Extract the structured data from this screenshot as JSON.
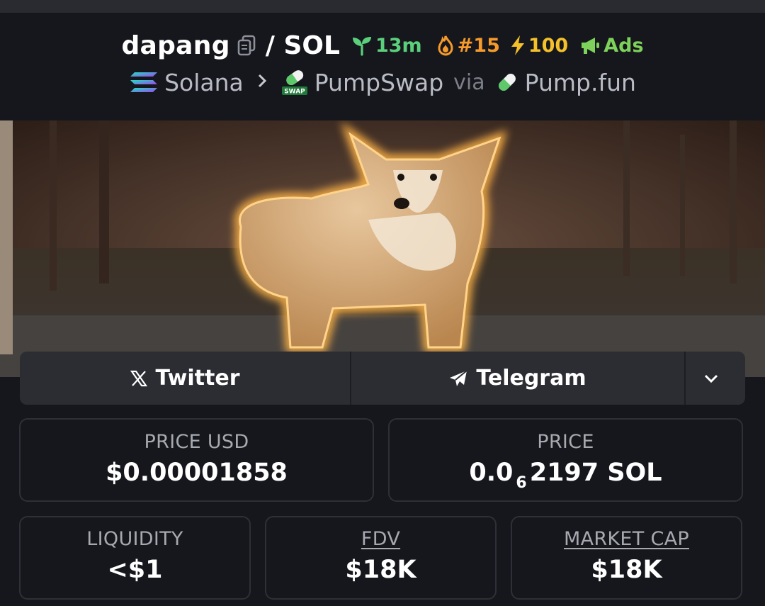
{
  "header": {
    "token": "dapang",
    "quote": "/ SOL",
    "age": "13m",
    "rank": "#15",
    "boost": "100",
    "ads": "Ads",
    "chain": "Solana",
    "dex": "PumpSwap",
    "via": "via",
    "launchpad": "Pump.fun",
    "dex_icon_text": "SWAP"
  },
  "socials": {
    "twitter": "Twitter",
    "telegram": "Telegram"
  },
  "stats": {
    "price_usd_label": "PRICE USD",
    "price_usd_value": "$0.00001858",
    "price_label": "PRICE",
    "price_prefix": "0.0",
    "price_subscript": "6",
    "price_rest": "2197 SOL",
    "liquidity_label": "LIQUIDITY",
    "liquidity_value": "<$1",
    "fdv_label": "FDV",
    "fdv_value": "$18K",
    "mcap_label": "MARKET CAP",
    "mcap_value": "$18K"
  },
  "colors": {
    "background": "#16171c",
    "age_green": "#5bd07c",
    "rank_orange": "#f59a2b",
    "boost_yellow": "#f4c12b",
    "ads_green": "#7ed15b"
  },
  "icons": [
    "copy-icon",
    "seedling-icon",
    "flame-icon",
    "bolt-icon",
    "megaphone-icon",
    "solana-icon",
    "chevron-right-icon",
    "pumpswap-icon",
    "pill-icon",
    "x-logo-icon",
    "paper-plane-icon",
    "chevron-down-icon"
  ]
}
